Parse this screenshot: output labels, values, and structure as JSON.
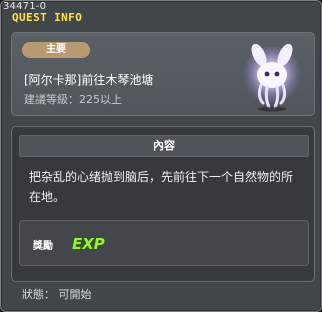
{
  "window": {
    "id_code": "34471-0",
    "title": "QUEST INFO"
  },
  "summary": {
    "badge": "主要",
    "quest_name": "[阿尔卡那]前往木琴池塘",
    "level_text": "建議等級：225以上"
  },
  "content": {
    "header": "內容",
    "description": "把杂乱的心绪抛到脑后，先前往下一个自然物的所在地。"
  },
  "reward": {
    "label": "獎勵",
    "exp_text": "EXP",
    "icon": "exp-icon"
  },
  "status": {
    "text": "狀態： 可開始"
  },
  "colors": {
    "title": "#ffe24a",
    "badge": "#b99a70",
    "exp": "#7ee02a"
  }
}
